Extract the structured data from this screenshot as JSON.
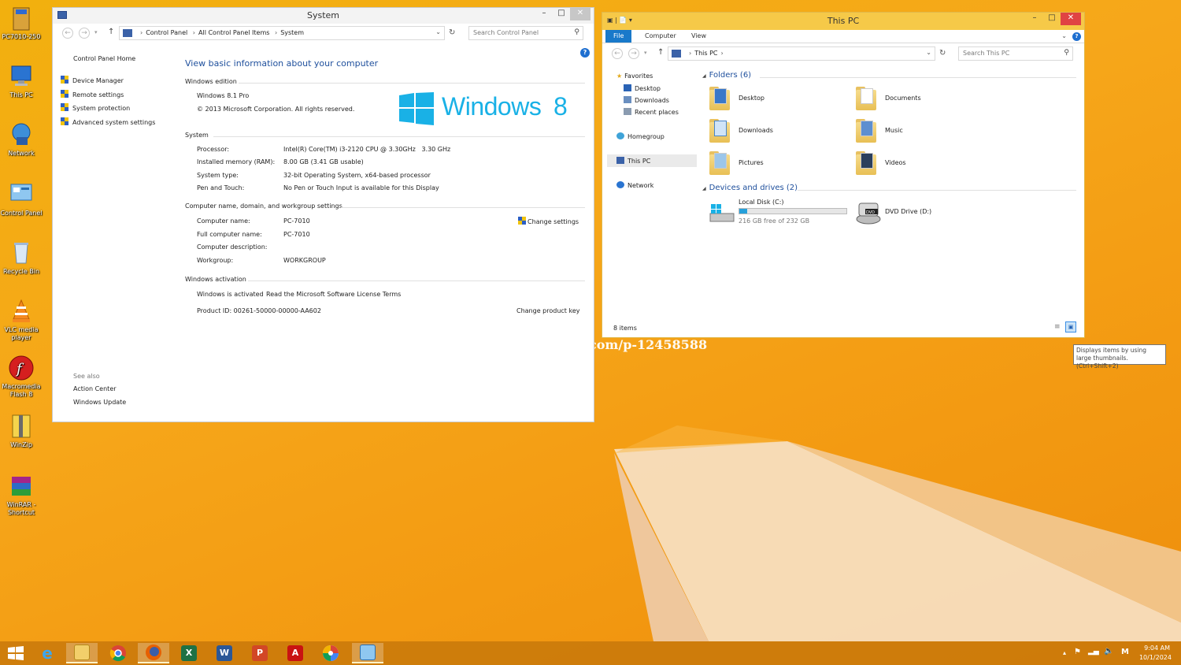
{
  "desktop": {
    "icons": [
      {
        "label": "PC7010-250",
        "icon": "folder-icon"
      },
      {
        "label": "This PC",
        "icon": "computer-icon"
      },
      {
        "label": "Network",
        "icon": "network-icon"
      },
      {
        "label": "Control Panel",
        "icon": "control-panel-icon"
      },
      {
        "label": "Recycle Bin",
        "icon": "recycle-bin-icon"
      },
      {
        "label": "VLC media player",
        "icon": "vlc-icon"
      },
      {
        "label": "Macromedia Flash 8",
        "icon": "flash-icon"
      },
      {
        "label": "WinZip",
        "icon": "winzip-icon"
      },
      {
        "label": "WinRAR - Shortcut",
        "icon": "winrar-icon"
      }
    ],
    "watermark": "com/p-12458588"
  },
  "system_window": {
    "title": "System",
    "breadcrumb": [
      "Control Panel",
      "All Control Panel Items",
      "System"
    ],
    "search_placeholder": "Search Control Panel",
    "sidebar": {
      "home": "Control Panel Home",
      "links": [
        "Device Manager",
        "Remote settings",
        "System protection",
        "Advanced system settings"
      ],
      "see_also_title": "See also",
      "see_also": [
        "Action Center",
        "Windows Update"
      ]
    },
    "heading": "View basic information about your computer",
    "edition": {
      "title": "Windows edition",
      "name": "Windows 8.1 Pro",
      "copyright": "© 2013 Microsoft Corporation. All rights reserved.",
      "logo_text": "Windows",
      "logo_version": "8"
    },
    "system": {
      "title": "System",
      "rows": [
        {
          "label": "Processor:",
          "value": "Intel(R) Core(TM) i3-2120 CPU @ 3.30GHz   3.30 GHz"
        },
        {
          "label": "Installed memory (RAM):",
          "value": "8.00 GB (3.41 GB usable)"
        },
        {
          "label": "System type:",
          "value": "32-bit Operating System, x64-based processor"
        },
        {
          "label": "Pen and Touch:",
          "value": "No Pen or Touch Input is available for this Display"
        }
      ]
    },
    "computer_name": {
      "title": "Computer name, domain, and workgroup settings",
      "change_label": "Change settings",
      "rows": [
        {
          "label": "Computer name:",
          "value": "PC-7010"
        },
        {
          "label": "Full computer name:",
          "value": "PC-7010"
        },
        {
          "label": "Computer description:",
          "value": ""
        },
        {
          "label": "Workgroup:",
          "value": "WORKGROUP"
        }
      ]
    },
    "activation": {
      "title": "Windows activation",
      "status": "Windows is activated",
      "license_link": "Read the Microsoft Software License Terms",
      "product_id": "Product ID: 00261-50000-00000-AA602",
      "change_key": "Change product key"
    }
  },
  "pc_window": {
    "title": "This PC",
    "tabs": [
      "File",
      "Computer",
      "View"
    ],
    "breadcrumb": "This PC",
    "search_placeholder": "Search This PC",
    "nav": {
      "favorites": "Favorites",
      "fav_items": [
        "Desktop",
        "Downloads",
        "Recent places"
      ],
      "homegroup": "Homegroup",
      "this_pc": "This PC",
      "network": "Network"
    },
    "folders_header": "Folders (6)",
    "folders": [
      "Desktop",
      "Documents",
      "Downloads",
      "Music",
      "Pictures",
      "Videos"
    ],
    "drives_header": "Devices and drives (2)",
    "local_disk": {
      "name": "Local Disk (C:)",
      "free": "216 GB free of 232 GB",
      "used_fraction": 0.07
    },
    "dvd": {
      "name": "DVD Drive (D:)",
      "badge": "DVD"
    },
    "status": "8 items",
    "tooltip": "Displays items by using large thumbnails.  (Ctrl+Shift+2)"
  },
  "taskbar": {
    "apps": [
      "start",
      "ie",
      "file-explorer",
      "chrome",
      "firefox",
      "excel",
      "word",
      "powerpoint",
      "acrobat",
      "picasa",
      "control-panel"
    ],
    "clock_time": "9:04 AM",
    "clock_date": "10/1/2024",
    "ime": "M"
  }
}
